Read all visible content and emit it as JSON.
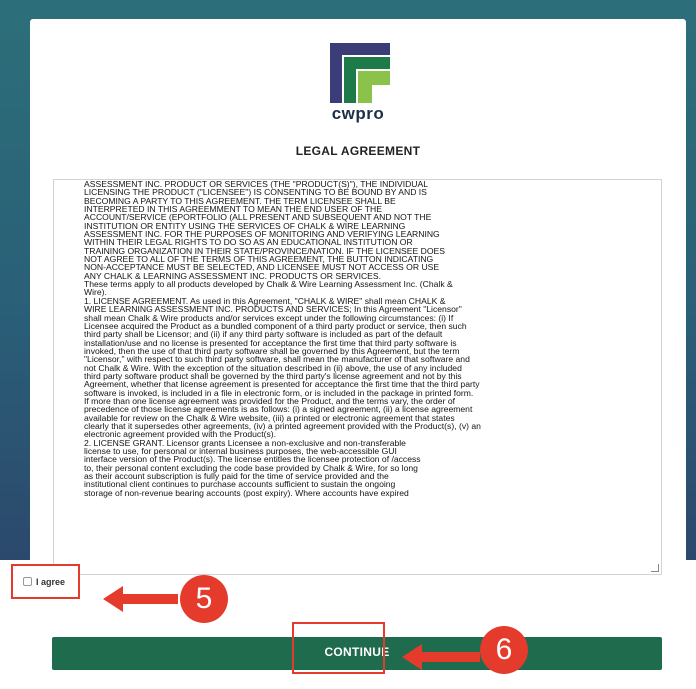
{
  "brand": {
    "name": "cwpro",
    "logo_icon": "cwpro-logo-icon",
    "colors": {
      "dark": "#3a3d78",
      "green": "#1f7a4a",
      "light_green": "#8bc34a"
    }
  },
  "page": {
    "title": "LEGAL AGREEMENT"
  },
  "agreement": {
    "text": "ASSESSMENT INC. PRODUCT OR SERVICES (THE \"PRODUCT(S)\"), THE INDIVIDUAL\nLICENSING THE PRODUCT (\"LICENSEE\") IS CONSENTING TO BE BOUND BY AND IS\nBECOMING A PARTY TO THIS AGREEMENT. THE TERM LICENSEE SHALL BE\nINTERPRETED IN THIS AGREEMMENT TO MEAN THE END USER OF THE\nACCOUNT/SERVICE (EPORTFOLIO (ALL PRESENT AND SUBSEQUENT AND NOT THE\nINSTITUTION OR ENTITY USING THE SERVICES OF CHALK & WIRE LEARNING\nASSESSMENT INC. FOR THE PURPOSES OF MONITORING AND VERIFYING LEARNING\nWITHIN THEIR LEGAL RIGHTS TO DO SO AS AN EDUCATIONAL INSTITUTION OR\nTRAINING ORGANIZATION IN THEIR STATE/PROVINCE/NATION. IF THE LICENSEE DOES\nNOT AGREE TO ALL OF THE TERMS OF THIS AGREEMENT, THE BUTTON INDICATING\nNON-ACCEPTANCE MUST BE SELECTED, AND LICENSEE MUST NOT ACCESS OR USE\nANY CHALK & LEARNING ASSESSMENT INC. PRODUCTS OR SERVICES.\nThese terms apply to all products developed by Chalk & Wire Learning Assessment Inc. (Chalk &\nWire).\n1. LICENSE AGREEMENT. As used in this Agreement, \"CHALK & WIRE\" shall mean CHALK &\nWIRE LEARNING ASSESSMENT INC. PRODUCTS AND SERVICES; In this Agreement \"Licensor\"\nshall mean Chalk & Wire products and/or services except under the following circumstances: (i) If\nLicensee acquired the Product as a bundled component of a third party product or service, then such\nthird party shall be Licensor; and (ii) if any third party software is included as part of the default\ninstallation/use and no license is presented for acceptance the first time that third party software is\ninvoked, then the use of that third party software shall be governed by this Agreement, but the term\n\"Licensor,\" with respect to such third party software, shall mean the manufacturer of that software and\nnot Chalk & Wire. With the exception of the situation described in (ii) above, the use of any included\nthird party software product shall be governed by the third party's license agreement and not by this\nAgreement, whether that license agreement is presented for acceptance the first time that the third party\nsoftware is invoked, is included in a file in electronic form, or is included in the package in printed form.\nIf more than one license agreement was provided for the Product, and the terms vary, the order of\nprecedence of those license agreements is as follows: (i) a signed agreement, (ii) a license agreement\navailable for review on the Chalk & Wire website, (iii) a printed or electronic agreement that states\nclearly that it supersedes other agreements, (iv) a printed agreement provided with the Product(s), (v) an\nelectronic agreement provided with the Product(s).\n2. LICENSE GRANT. Licensor grants Licensee a non-exclusive and non-transferable\nlicense to use, for personal or internal business purposes, the web-accessible GUI\ninterface version of the Product(s). The license entitles the licensee protection of /access\nto, their personal content excluding the code base provided by Chalk & Wire, for so long\nas their account subscription is fully paid for the time of service provided and the\ninstitutional client continues to purchase accounts sufficient to sustain the ongoing\nstorage of non-revenue bearing accounts (post expiry). Where accounts have expired"
  },
  "agree": {
    "label": "I agree",
    "checked": false
  },
  "continue": {
    "label": "CONTINUE"
  },
  "annotations": {
    "step_5": "5",
    "step_6": "6",
    "color": "#e53b2c"
  }
}
